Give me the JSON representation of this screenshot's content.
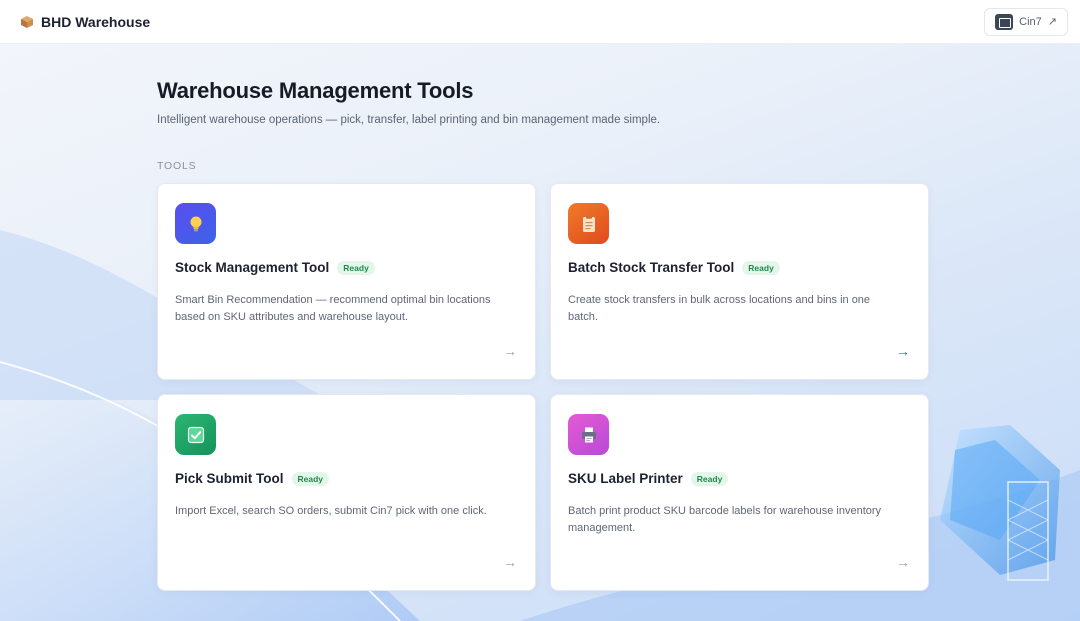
{
  "header": {
    "title": "BHD Warehouse",
    "brand_icon": "package-box-icon",
    "external_link": {
      "label": "Cin7",
      "icon": "external-link-icon"
    }
  },
  "main": {
    "title": "Warehouse Management Tools",
    "subtitle": "Intelligent warehouse operations — pick, transfer, label printing and bin management made simple.",
    "section_label": "TOOLS",
    "tools": [
      {
        "title": "Stock Management Tool",
        "status": "Ready",
        "icon": "lightbulb-icon",
        "icon_color": "#4f57ee",
        "description": "Smart Bin Recommendation — recommend optimal bin locations based on SKU attributes and warehouse layout.",
        "arrow": "→"
      },
      {
        "title": "Batch Stock Transfer Tool",
        "status": "Ready",
        "icon": "clipboard-icon",
        "icon_color": "#e95f22",
        "description": "Create stock transfers in bulk across locations and bins in one batch.",
        "arrow": "→"
      },
      {
        "title": "Pick Submit Tool",
        "status": "Ready",
        "icon": "checkbox-icon",
        "icon_color": "#1fa867",
        "description": "Import Excel, search SO orders, submit Cin7 pick with one click.",
        "arrow": "→"
      },
      {
        "title": "SKU Label Printer",
        "status": "Ready",
        "icon": "printer-icon",
        "icon_color": "#d250d4",
        "description": "Batch print product SKU barcode labels for warehouse inventory management.",
        "arrow": "→"
      }
    ]
  }
}
